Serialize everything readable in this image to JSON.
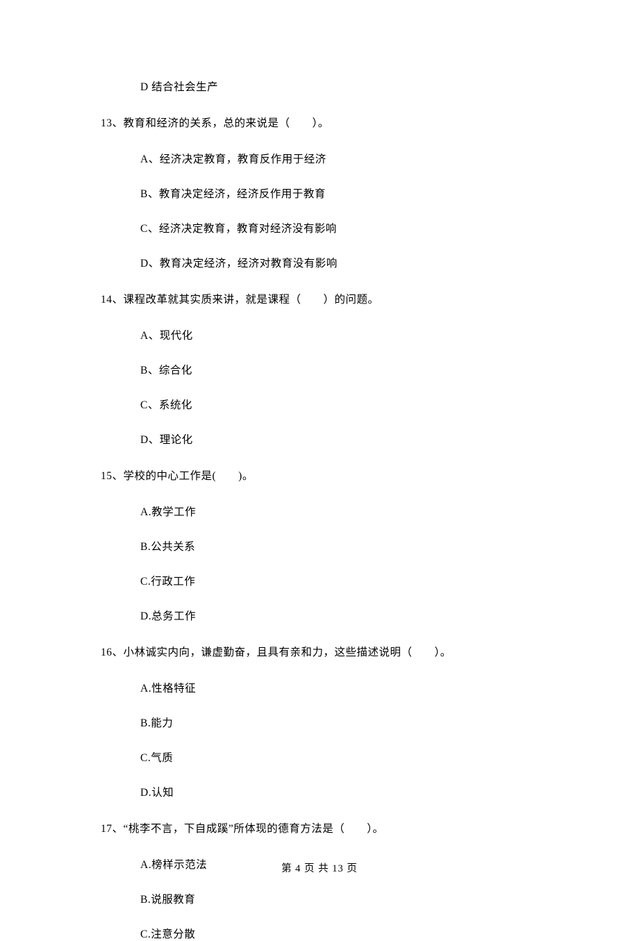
{
  "orphan_option": "D 结合社会生产",
  "questions": [
    {
      "stem": "13、教育和经济的关系，总的来说是（　　）。",
      "options": [
        "A、经济决定教育，教育反作用于经济",
        "B、教育决定经济，经济反作用于教育",
        "C、经济决定教育，教育对经济没有影响",
        "D、教育决定经济，经济对教育没有影响"
      ]
    },
    {
      "stem": "14、课程改革就其实质来讲，就是课程（　　）的问题。",
      "options": [
        "A、现代化",
        "B、综合化",
        "C、系统化",
        "D、理论化"
      ]
    },
    {
      "stem": "15、学校的中心工作是(　　)。",
      "options": [
        "A.教学工作",
        "B.公共关系",
        "C.行政工作",
        "D.总务工作"
      ]
    },
    {
      "stem": "16、小林诚实内向，谦虚勤奋，且具有亲和力，这些描述说明（　　）。",
      "options": [
        "A.性格特征",
        "B.能力",
        "C.气质",
        "D.认知"
      ]
    },
    {
      "stem": "17、“桃李不言，下自成蹊”所体现的德育方法是（　　）。",
      "options": [
        "A.榜样示范法",
        "B.说服教育",
        "C.注意分散"
      ]
    }
  ],
  "footer": "第 4 页 共 13 页"
}
